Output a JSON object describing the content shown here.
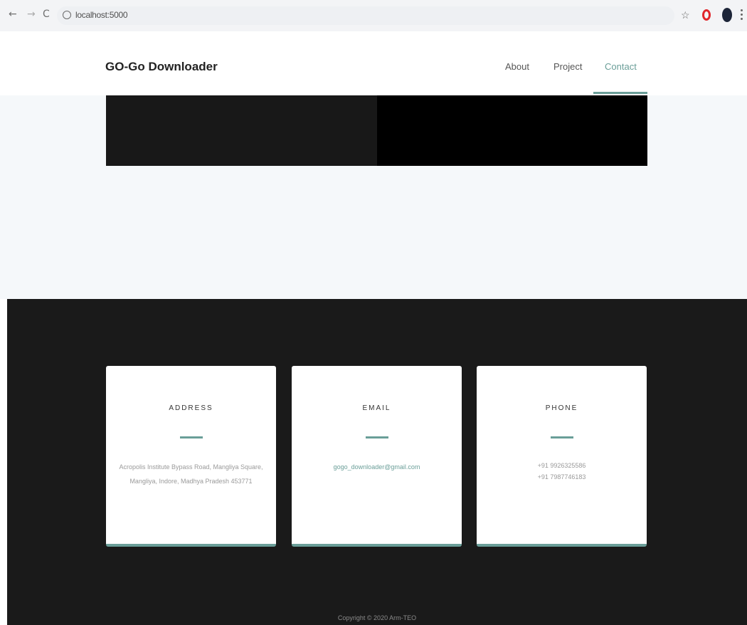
{
  "browser": {
    "back_icon": "←",
    "forward_icon": "→",
    "reload_icon": "C",
    "url": "localhost:5000",
    "star_icon": "☆"
  },
  "nav": {
    "brand": "GO-Go Downloader",
    "links": [
      "About",
      "Project",
      "Contact"
    ],
    "active": "Contact",
    "accent_color": "#6a9e98"
  },
  "cards": [
    {
      "title": "ADDRESS",
      "lines": [
        "Acropolis Institute Bypass Road, Mangliya Square, Mangliya, Indore, Madhya Pradesh 453771"
      ]
    },
    {
      "title": "EMAIL",
      "lines": [
        "gogo_downloader@gmail.com"
      ]
    },
    {
      "title": "PHONE",
      "lines": [
        "+91 9926325586",
        "+91 7987746183"
      ]
    }
  ],
  "footer": {
    "copyright": "Copyright © 2020 Arm-TEO"
  }
}
